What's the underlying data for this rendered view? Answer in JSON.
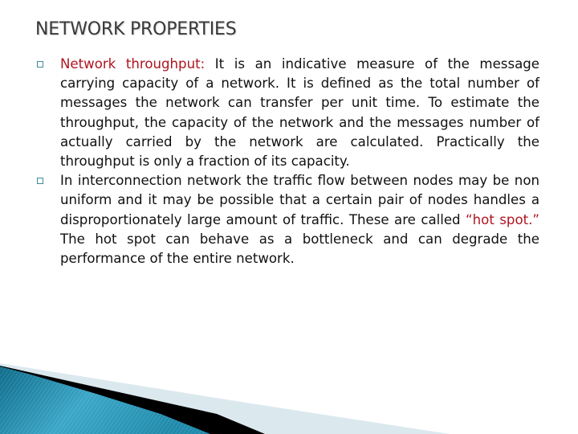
{
  "slide": {
    "title": "NETWORK PROPERTIES",
    "bullets": [
      {
        "marker_icon": "hollow-square-bullet",
        "highlight": "Network throughput:",
        "text": " It is an indicative measure of the message carrying capacity of a network. It is defined as the total number of messages the network can transfer per unit time. To estimate the throughput, the capacity of the network and the messages number of actually carried by the network are calculated. Practically the throughput is only a fraction of its capacity."
      },
      {
        "marker_icon": "hollow-square-bullet",
        "text_before": "In interconnection network the traffic flow between nodes may be non uniform and it may be possible that a certain pair of nodes handles a disproportionately large amount of traffic. These are called ",
        "highlight": "“hot spot.”",
        "text_after": " The hot spot can behave as a bottleneck and can degrade the performance of the entire network."
      }
    ]
  },
  "colors": {
    "highlight": "#b0141f",
    "title": "#3a3a3a",
    "body": "#111111",
    "bullet_marker": "#3f8a99",
    "accent_blue": "#2a8fb0",
    "accent_light": "#dbe9ef"
  }
}
